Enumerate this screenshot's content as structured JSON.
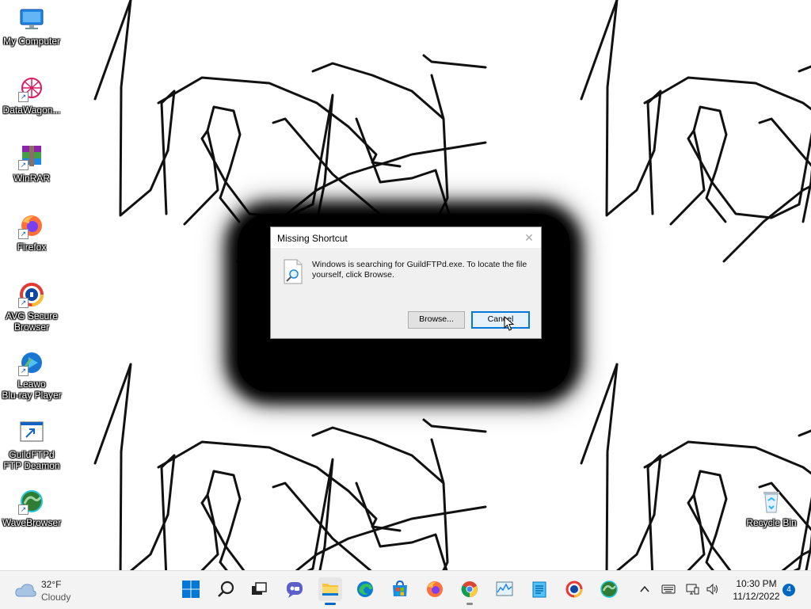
{
  "desktop": {
    "icons": [
      {
        "label": "My Computer"
      },
      {
        "label": "DataWagon..."
      },
      {
        "label": "WinRAR"
      },
      {
        "label": "Firefox"
      },
      {
        "label": "AVG Secure\nBrowser"
      },
      {
        "label": "Leawo\nBlu-ray Player"
      },
      {
        "label": "GuildFTPd\nFTP Deamon"
      },
      {
        "label": "WaveBrowser"
      },
      {
        "label": "Recycle Bin"
      }
    ]
  },
  "dialog": {
    "title": "Missing Shortcut",
    "close_glyph": "✕",
    "message": "Windows is searching for GuildFTPd.exe. To locate the file yourself, click Browse.",
    "browse_label": "Browse...",
    "cancel_label": "Cancel"
  },
  "taskbar": {
    "weather_temp": "32°F",
    "weather_condition": "Cloudy",
    "apps": [
      "windows-start-icon",
      "search-icon",
      "task-view-icon",
      "chat-icon",
      "file-explorer-icon",
      "edge-icon",
      "microsoft-store-icon",
      "firefox-icon",
      "chrome-icon",
      "performance-monitor-icon",
      "notepad-icon",
      "avg-browser-icon",
      "wavebrowser-icon"
    ],
    "tray": {
      "time": "10:30 PM",
      "date": "11/12/2022",
      "notification_count": "4"
    }
  },
  "colors": {
    "accent": "#0067c0",
    "dialog_bg": "#f0f0f0",
    "taskbar_bg": "#f3f3f3"
  }
}
